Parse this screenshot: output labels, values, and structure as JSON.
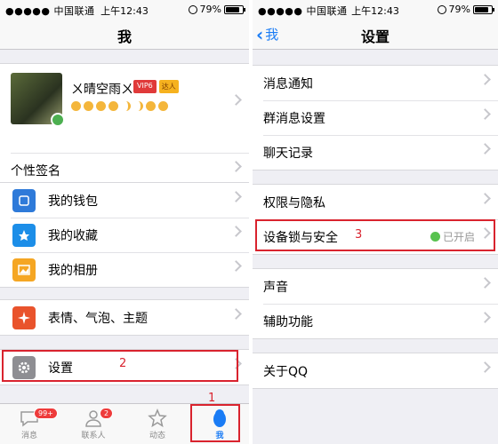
{
  "status": {
    "carrier": "●●●●● 中国联通",
    "time": "上午12:43",
    "battery": "79%"
  },
  "left": {
    "title": "我",
    "profile": {
      "nickname": "ㄨ晴空雨ㄨ",
      "vip": "VIP6",
      "daren": "达人"
    },
    "signature": "个性签名",
    "wallet": "我的钱包",
    "favorites": "我的收藏",
    "album": "我的相册",
    "emotions": "表情、气泡、主题",
    "settings": "设置",
    "annotation_settings": "2",
    "annotation_tab": "1",
    "tabs": [
      {
        "label": "消息",
        "badge": "99+"
      },
      {
        "label": "联系人",
        "badge": "2"
      },
      {
        "label": "动态"
      },
      {
        "label": "我"
      }
    ]
  },
  "right": {
    "back": "我",
    "title": "设置",
    "items": {
      "notify": "消息通知",
      "group_msg": "群消息设置",
      "chat_history": "聊天记录",
      "privacy": "权限与隐私",
      "device_lock": "设备锁与安全",
      "device_lock_status": "已开启",
      "annotation_device": "3",
      "sound": "声音",
      "accessibility": "辅助功能",
      "about": "关于QQ"
    }
  },
  "colors": {
    "accent": "#1a7cf5",
    "annotation": "#d9232e",
    "badge": "#ee3b3b"
  }
}
